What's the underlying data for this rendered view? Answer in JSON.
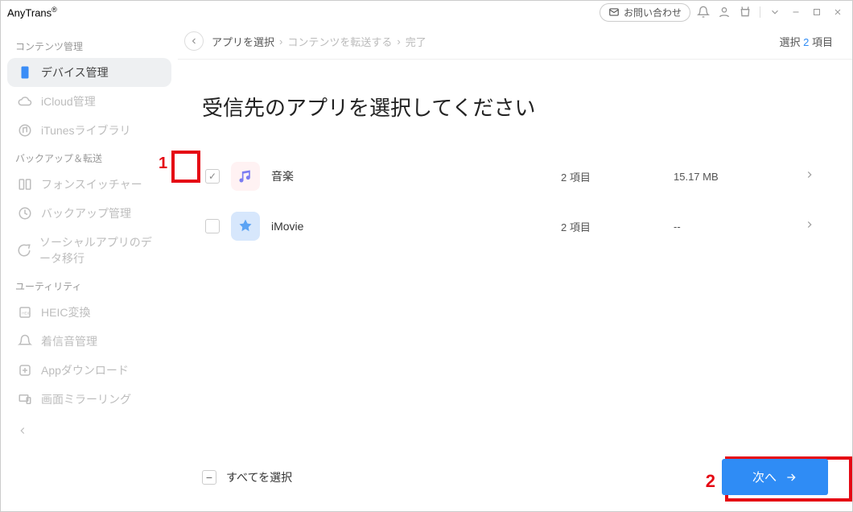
{
  "app_name": "AnyTrans",
  "app_superscript": "®",
  "titlebar": {
    "contact_label": "お問い合わせ"
  },
  "sidebar": {
    "section1_label": "コンテンツ管理",
    "items_section1": [
      {
        "label": "デバイス管理",
        "icon": "device"
      },
      {
        "label": "iCloud管理",
        "icon": "icloud"
      },
      {
        "label": "iTunesライブラリ",
        "icon": "itunes"
      }
    ],
    "section2_label": "バックアップ＆転送",
    "items_section2": [
      {
        "label": "フォンスイッチャー",
        "icon": "switch"
      },
      {
        "label": "バックアップ管理",
        "icon": "backup"
      },
      {
        "label": "ソーシャルアプリのデータ移行",
        "icon": "social"
      }
    ],
    "section3_label": "ユーティリティ",
    "items_section3": [
      {
        "label": "HEIC変換",
        "icon": "heic"
      },
      {
        "label": "着信音管理",
        "icon": "ringtone"
      },
      {
        "label": "Appダウンロード",
        "icon": "appdl"
      },
      {
        "label": "画面ミラーリング",
        "icon": "mirror"
      }
    ]
  },
  "breadcrumb": {
    "step1": "アプリを選択",
    "step2": "コンテンツを転送する",
    "step3": "完了",
    "selection_prefix": "選択",
    "selection_count": "2",
    "selection_suffix": "項目"
  },
  "main": {
    "page_title": "受信先のアプリを選択してください",
    "rows": [
      {
        "name": "音楽",
        "count": "2 項目",
        "size": "15.17 MB",
        "checked": true,
        "icon": "music"
      },
      {
        "name": "iMovie",
        "count": "2 項目",
        "size": "--",
        "checked": false,
        "icon": "imovie"
      }
    ],
    "select_all_label": "すべてを選択",
    "next_label": "次へ"
  },
  "annotations": {
    "num1": "1",
    "num2": "2"
  }
}
